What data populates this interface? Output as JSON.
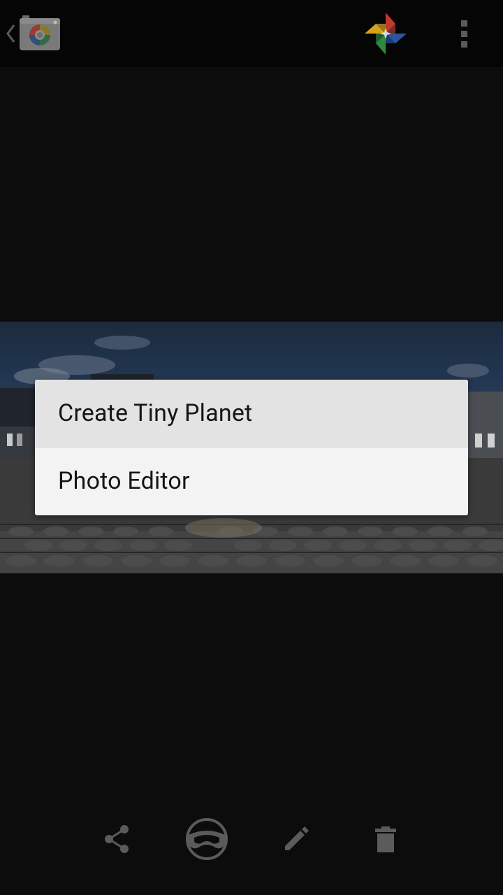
{
  "colors": {
    "background": "#0c0c0c",
    "action_bar": "#050505",
    "icon_gray": "#5b5b5b",
    "dialog_bg": "#f3f3f3",
    "dialog_pressed": "#e3e3e3"
  },
  "action_bar": {
    "up_icon": "chevron-left-icon",
    "app_icon": "camera-app-icon",
    "photos_icon": "google-photos-pinwheel-icon",
    "overflow_icon": "overflow-menu-icon"
  },
  "menu": {
    "items": [
      {
        "label": "Create Tiny Planet",
        "pressed": true
      },
      {
        "label": "Photo Editor",
        "pressed": false
      }
    ]
  },
  "bottom_bar": {
    "buttons": [
      {
        "icon": "share-icon"
      },
      {
        "icon": "panorama-viewer-icon"
      },
      {
        "icon": "edit-pencil-icon"
      },
      {
        "icon": "delete-trash-icon"
      }
    ]
  }
}
